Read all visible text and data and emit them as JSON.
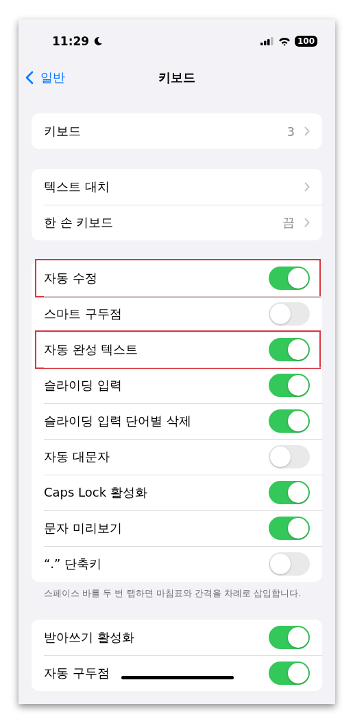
{
  "status": {
    "time": "11:29",
    "battery": "100"
  },
  "nav": {
    "back": "일반",
    "title": "키보드"
  },
  "groups": [
    {
      "rows": [
        {
          "kind": "value",
          "label": "키보드",
          "value": "3"
        }
      ]
    },
    {
      "rows": [
        {
          "kind": "link",
          "label": "텍스트 대치"
        },
        {
          "kind": "value",
          "label": "한 손 키보드",
          "value": "끔"
        }
      ]
    },
    {
      "rows": [
        {
          "kind": "toggle",
          "label": "자동 수정",
          "on": true,
          "highlighted": true
        },
        {
          "kind": "toggle",
          "label": "스마트 구두점",
          "on": false,
          "highlighted": false
        },
        {
          "kind": "toggle",
          "label": "자동 완성 텍스트",
          "on": true,
          "highlighted": true
        },
        {
          "kind": "toggle",
          "label": "슬라이딩 입력",
          "on": true,
          "highlighted": false
        },
        {
          "kind": "toggle",
          "label": "슬라이딩 입력 단어별 삭제",
          "on": true,
          "highlighted": false
        },
        {
          "kind": "toggle",
          "label": "자동 대문자",
          "on": false,
          "highlighted": false
        },
        {
          "kind": "toggle",
          "label": "Caps Lock 활성화",
          "on": true,
          "highlighted": false
        },
        {
          "kind": "toggle",
          "label": "문자 미리보기",
          "on": true,
          "highlighted": false
        },
        {
          "kind": "toggle",
          "label": "“.” 단축키",
          "on": false,
          "highlighted": false
        }
      ],
      "footer": "스페이스 바를 두 번 탭하면 마침표와 간격을 차례로 삽입합니다."
    },
    {
      "rows": [
        {
          "kind": "toggle",
          "label": "받아쓰기 활성화",
          "on": true,
          "highlighted": false
        },
        {
          "kind": "toggle",
          "label": "자동 구두점",
          "on": true,
          "highlighted": false
        }
      ]
    }
  ]
}
